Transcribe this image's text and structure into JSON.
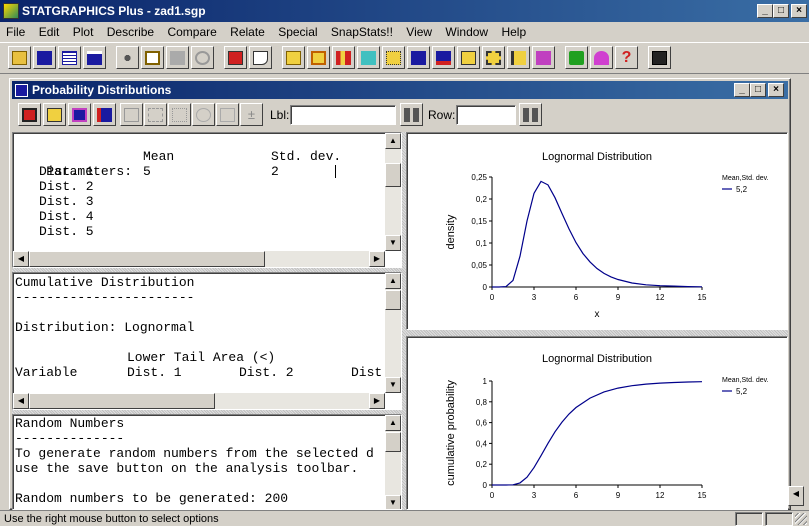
{
  "app": {
    "title": "STATGRAPHICS Plus - zad1.sgp",
    "menu": [
      "File",
      "Edit",
      "Plot",
      "Describe",
      "Compare",
      "Relate",
      "Special",
      "SnapStats!!",
      "View",
      "Window",
      "Help"
    ]
  },
  "child": {
    "title": "Probability Distributions",
    "lbl_label": "Lbl:",
    "row_label": "Row:",
    "lbl_value": "",
    "row_value": ""
  },
  "params": {
    "header_params": "Parameters:",
    "header_mean": "Mean",
    "header_sd": "Std. dev.",
    "rows": [
      {
        "label": "Dist. 1",
        "mean": "5",
        "sd": "2"
      },
      {
        "label": "Dist. 2",
        "mean": "",
        "sd": ""
      },
      {
        "label": "Dist. 3",
        "mean": "",
        "sd": ""
      },
      {
        "label": "Dist. 4",
        "mean": "",
        "sd": ""
      },
      {
        "label": "Dist. 5",
        "mean": "",
        "sd": ""
      }
    ]
  },
  "cumulative": {
    "heading": "Cumulative Distribution",
    "rule": "-----------------------",
    "distribution_line": "Distribution: Lognormal",
    "lower_tail": "Lower Tail Area (<)",
    "col_variable": "Variable",
    "col_d1": "Dist. 1",
    "col_d2": "Dist. 2",
    "col_d3": "Dist"
  },
  "random": {
    "heading": "Random Numbers",
    "rule": "--------------",
    "line1": "To generate random numbers from the selected d",
    "line2": "use the save button on the analysis toolbar.",
    "line3": "Random numbers to be generated: 200"
  },
  "status": {
    "text": "Use the right mouse button to select options"
  },
  "chart_data": [
    {
      "type": "line",
      "title": "Lognormal Distribution",
      "xlabel": "x",
      "ylabel": "density",
      "xlim": [
        0,
        15
      ],
      "ylim": [
        0,
        0.25
      ],
      "xticks": [
        0,
        3,
        6,
        9,
        12,
        15
      ],
      "yticks": [
        "0",
        "0,05",
        "0,1",
        "0,15",
        "0,2",
        "0,25"
      ],
      "yticks_values": [
        0,
        0.05,
        0.1,
        0.15,
        0.2,
        0.25
      ],
      "legend_title": "Mean,Std. dev.",
      "series": [
        {
          "name": "5,2",
          "color": "#00008b",
          "x": [
            0,
            0.5,
            1,
            1.5,
            2,
            2.5,
            3,
            3.5,
            4,
            4.5,
            5,
            5.5,
            6,
            6.5,
            7,
            7.5,
            8,
            8.5,
            9,
            10,
            11,
            12,
            13,
            14,
            15
          ],
          "y": [
            0,
            0,
            0.001,
            0.015,
            0.07,
            0.15,
            0.213,
            0.24,
            0.232,
            0.203,
            0.167,
            0.132,
            0.101,
            0.076,
            0.057,
            0.042,
            0.031,
            0.023,
            0.017,
            0.009,
            0.005,
            0.003,
            0.002,
            0.001,
            0.0005
          ]
        }
      ]
    },
    {
      "type": "line",
      "title": "Lognormal Distribution",
      "xlabel": "",
      "ylabel": "cumulative probability",
      "xlim": [
        0,
        15
      ],
      "ylim": [
        0,
        1
      ],
      "xticks": [
        0,
        3,
        6,
        9,
        12,
        15
      ],
      "yticks": [
        "0",
        "0,2",
        "0,4",
        "0,6",
        "0,8",
        "1"
      ],
      "yticks_values": [
        0,
        0.2,
        0.4,
        0.6,
        0.8,
        1
      ],
      "legend_title": "Mean,Std. dev.",
      "series": [
        {
          "name": "5,2",
          "color": "#00008b",
          "x": [
            0,
            1,
            1.5,
            2,
            2.5,
            3,
            3.5,
            4,
            4.5,
            5,
            5.5,
            6,
            7,
            8,
            9,
            10,
            11,
            12,
            13,
            14,
            15
          ],
          "y": [
            0,
            0,
            0.002,
            0.02,
            0.075,
            0.167,
            0.282,
            0.401,
            0.512,
            0.605,
            0.683,
            0.745,
            0.836,
            0.895,
            0.932,
            0.955,
            0.97,
            0.98,
            0.986,
            0.99,
            0.993
          ]
        }
      ]
    }
  ]
}
